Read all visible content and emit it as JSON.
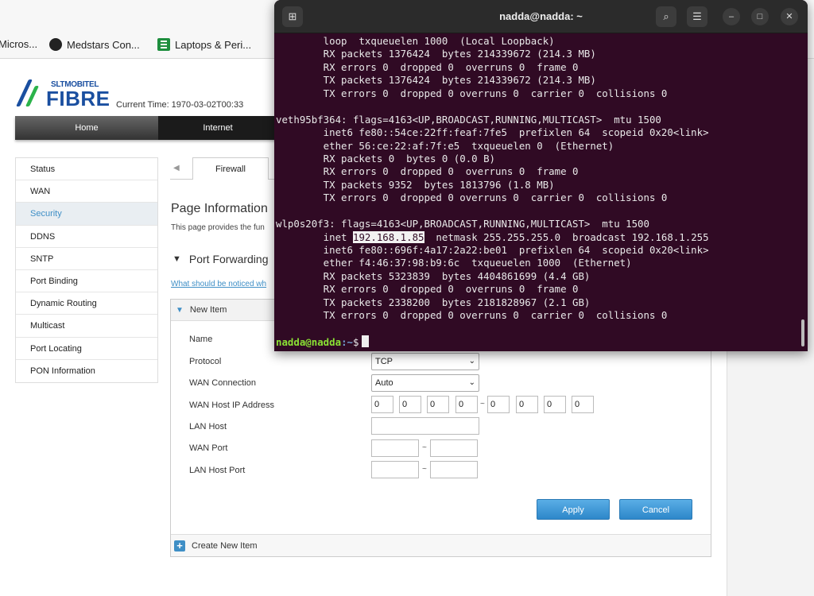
{
  "bookmarks": [
    {
      "label": "Micros..."
    },
    {
      "label": "Medstars Con..."
    },
    {
      "label": "Laptops & Peri..."
    }
  ],
  "router": {
    "logo_small": "SLTMOBITEL",
    "logo_big": "FIBRE",
    "current_time": "Current Time: 1970-03-02T00:33",
    "nav": [
      "Home",
      "Internet"
    ],
    "side_menu": [
      "Status",
      "WAN",
      "Security",
      "DDNS",
      "SNTP",
      "Port Binding",
      "Dynamic Routing",
      "Multicast",
      "Port Locating",
      "PON Information"
    ],
    "active_menu": "Security",
    "subtab": "Firewall",
    "page_title": "Page Information",
    "page_desc": "This page provides the fun",
    "section_title": "Port Forwarding",
    "notice_link": "What should be noticed wh",
    "form": {
      "header": "New Item",
      "name_label": "Name",
      "protocol_label": "Protocol",
      "protocol_value": "TCP",
      "wan_conn_label": "WAN Connection",
      "wan_conn_value": "Auto",
      "wan_host_ip_label": "WAN Host IP Address",
      "ip_octets": [
        "0",
        "0",
        "0",
        "0",
        "0",
        "0",
        "0",
        "0"
      ],
      "ip_range_sep": "~",
      "lan_host_label": "LAN Host",
      "wan_port_label": "WAN Port",
      "lan_host_port_label": "LAN Host Port",
      "port_sep": "~",
      "apply": "Apply",
      "cancel": "Cancel",
      "create_new": "Create New Item"
    }
  },
  "terminal": {
    "title": "nadda@nadda: ~",
    "lines": [
      "        loop  txqueuelen 1000  (Local Loopback)",
      "        RX packets 1376424  bytes 214339672 (214.3 MB)",
      "        RX errors 0  dropped 0  overruns 0  frame 0",
      "        TX packets 1376424  bytes 214339672 (214.3 MB)",
      "        TX errors 0  dropped 0 overruns 0  carrier 0  collisions 0",
      "",
      "veth95bf364: flags=4163<UP,BROADCAST,RUNNING,MULTICAST>  mtu 1500",
      "        inet6 fe80::54ce:22ff:feaf:7fe5  prefixlen 64  scopeid 0x20<link>",
      "        ether 56:ce:22:af:7f:e5  txqueuelen 0  (Ethernet)",
      "        RX packets 0  bytes 0 (0.0 B)",
      "        RX errors 0  dropped 0  overruns 0  frame 0",
      "        TX packets 9352  bytes 1813796 (1.8 MB)",
      "        TX errors 0  dropped 0 overruns 0  carrier 0  collisions 0",
      "",
      "wlp0s20f3: flags=4163<UP,BROADCAST,RUNNING,MULTICAST>  mtu 1500"
    ],
    "inet_prefix": "        inet ",
    "inet_ip": "192.168.1.85",
    "inet_rest": "  netmask 255.255.255.0  broadcast 192.168.1.255",
    "lines_after": [
      "        inet6 fe80::696f:4a17:2a22:be01  prefixlen 64  scopeid 0x20<link>",
      "        ether f4:46:37:98:b9:6c  txqueuelen 1000  (Ethernet)",
      "        RX packets 5323839  bytes 4404861699 (4.4 GB)",
      "        RX errors 0  dropped 0  overruns 0  frame 0",
      "        TX packets 2338200  bytes 2181828967 (2.1 GB)",
      "        TX errors 0  dropped 0 overruns 0  carrier 0  collisions 0",
      ""
    ],
    "prompt_user": "nadda@nadda",
    "prompt_path": ":~",
    "prompt_symbol": "$"
  }
}
